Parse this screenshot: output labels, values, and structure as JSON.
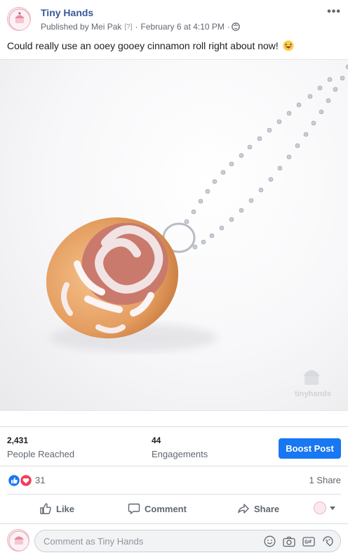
{
  "post": {
    "page_name": "Tiny Hands",
    "published_by": "Published by Mei Pak",
    "help_marker": "[?]",
    "separator": "·",
    "timestamp": "February 6 at 4:10 PM",
    "privacy_icon": "globe-icon",
    "more_icon": "more-options-icon",
    "text": "Could really use an ooey gooey cinnamon roll right about now!",
    "emoji": "grinning-squinting-tongue-emoji"
  },
  "photo": {
    "subject": "cinnamon-roll-charm-necklace",
    "watermark": "tinyhands"
  },
  "stats": {
    "reached_value": "2,431",
    "reached_label": "People Reached",
    "engagements_value": "44",
    "engagements_label": "Engagements",
    "boost_label": "Boost Post"
  },
  "reactions": {
    "icons": [
      "like-reaction-icon",
      "love-reaction-icon"
    ],
    "count": "31",
    "shares": "1 Share"
  },
  "actions": {
    "like": "Like",
    "comment": "Comment",
    "share": "Share"
  },
  "comment_box": {
    "placeholder": "Comment as Tiny Hands",
    "icons": [
      "emoji-icon",
      "camera-icon",
      "gif-icon",
      "sticker-icon"
    ]
  },
  "colors": {
    "brand_link": "#385898",
    "boost_blue": "#1877f2",
    "like_blue": "#1877f2",
    "love_red": "#f33e58",
    "muted": "#606770"
  }
}
